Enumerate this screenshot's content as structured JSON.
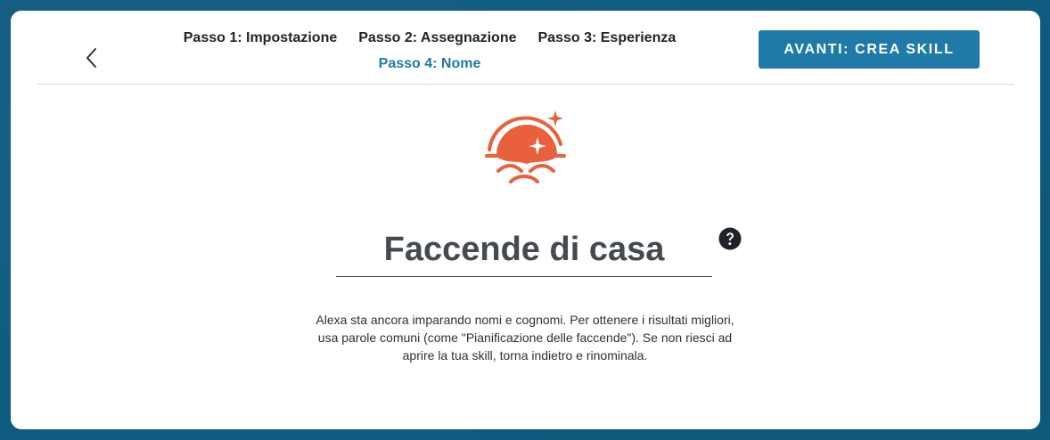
{
  "header": {
    "back_icon": "chevron-left-icon",
    "steps": [
      {
        "label": "Passo 1: Impostazione",
        "active": false
      },
      {
        "label": "Passo 2: Assegnazione",
        "active": false
      },
      {
        "label": "Passo 3: Esperienza",
        "active": false
      },
      {
        "label": "Passo 4: Nome",
        "active": true
      }
    ],
    "next_button_label": "AVANTI: CREA SKILL"
  },
  "main": {
    "hero_icon": "sunrise-sparkle-icon",
    "skill_name": "Faccende di casa",
    "help_icon": "question-circle-icon",
    "hint_text": "Alexa sta ancora imparando nomi e cognomi. Per ottenere i risultati migliori, usa parole comuni (come \"Pianificazione delle faccende\"). Se non riesci ad aprire la tua skill, torna indietro e rinominala."
  },
  "colors": {
    "accent": "#1f7aa7",
    "hero_orange": "#e8603c",
    "background": "#0f5b80",
    "text_dark": "#1f2328"
  }
}
